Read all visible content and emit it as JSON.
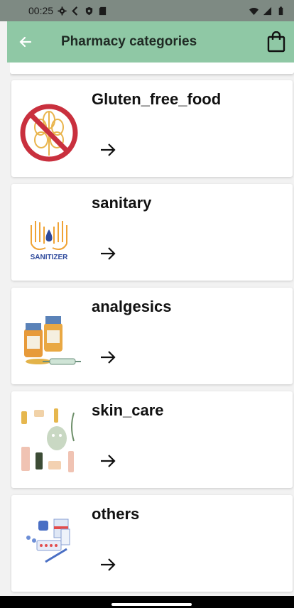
{
  "status_bar": {
    "time": "00:25"
  },
  "app_bar": {
    "title": "Pharmacy categories"
  },
  "categories": [
    {
      "label": "Gluten_free_food",
      "image": "gluten-free-icon"
    },
    {
      "label": "sanitary",
      "image": "sanitizer-icon",
      "image_text": "SANITIZER"
    },
    {
      "label": "analgesics",
      "image": "medicine-bottles-icon"
    },
    {
      "label": "skin_care",
      "image": "skin-care-products-icon"
    },
    {
      "label": "others",
      "image": "pharmacy-supplies-icon"
    }
  ],
  "colors": {
    "app_bar": "#8fc8a5",
    "status_bar": "#7e8a83",
    "background": "#f2f2f2",
    "card": "#ffffff"
  }
}
